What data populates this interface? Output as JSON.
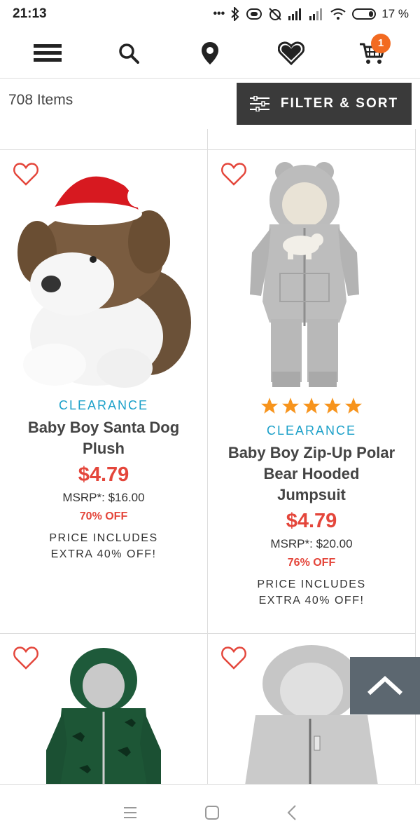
{
  "status": {
    "time": "21:13",
    "battery": "17 %"
  },
  "header": {
    "cart_count": "1"
  },
  "toolbar": {
    "items_count": "708 Items",
    "filter_label": "FILTER & SORT"
  },
  "products": [
    {
      "badge": "CLEARANCE",
      "name": "Baby Boy Santa Dog Plush",
      "price": "$4.79",
      "msrp": "MSRP*: $16.00",
      "off": "70% OFF",
      "extra": "PRICE INCLUDES EXTRA 40% OFF!"
    },
    {
      "rating": "5",
      "badge": "CLEARANCE",
      "name": "Baby Boy Zip-Up Polar Bear Hooded Jumpsuit",
      "price": "$4.79",
      "msrp": "MSRP*: $20.00",
      "off": "76% OFF",
      "extra": "PRICE INCLUDES EXTRA 40% OFF!"
    }
  ],
  "colors": {
    "accent_red": "#e4463b",
    "clearance_blue": "#1ba0c9",
    "badge_orange": "#f26a21",
    "dark_button": "#3a3a3a",
    "star": "#f7941d"
  },
  "icons": [
    "menu-icon",
    "search-icon",
    "location-icon",
    "heart-icon",
    "cart-icon",
    "filter-icon",
    "chevron-up-icon"
  ]
}
